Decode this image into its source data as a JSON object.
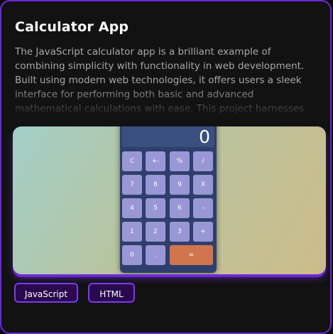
{
  "project": {
    "title": "Calculator App",
    "description": "The JavaScript calculator app is a brilliant example of combining simplicity with functionality in web development. Built using modern web technologies, it offers users a sleek interface for performing both basic and advanced mathematical calculations with ease. This project harnesses the power of J...",
    "tags": [
      "JavaScript",
      "HTML"
    ]
  },
  "calculator_preview": {
    "display": "0",
    "keys": [
      [
        "C",
        "+-",
        "%",
        "/"
      ],
      [
        "7",
        "8",
        "9",
        "X"
      ],
      [
        "4",
        "5",
        "6",
        "-"
      ],
      [
        "1",
        "2",
        "3",
        "+"
      ],
      [
        "0",
        ".",
        "="
      ]
    ]
  },
  "colors": {
    "card_border": "#6d28d9",
    "tag_border": "#7c3aed",
    "tag_background": "#2a0a4e",
    "calc_body": "#2f3f6b",
    "calc_key": "#9a97d6",
    "calc_equals": "#d0754e"
  }
}
